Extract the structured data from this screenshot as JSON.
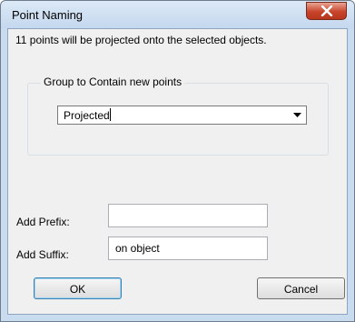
{
  "window": {
    "title": "Point Naming"
  },
  "message": "11 points will be projected onto the selected objects.",
  "group": {
    "legend": "Group to Contain new points",
    "selected": "Projected"
  },
  "prefix": {
    "label": "Add Prefix:",
    "value": ""
  },
  "suffix": {
    "label": "Add Suffix:",
    "value": "on object"
  },
  "buttons": {
    "ok": "OK",
    "cancel": "Cancel"
  },
  "colors": {
    "close_button": "#c8452c",
    "title_bar": "#c5d8ee",
    "client_bg": "#f0f0f0"
  }
}
